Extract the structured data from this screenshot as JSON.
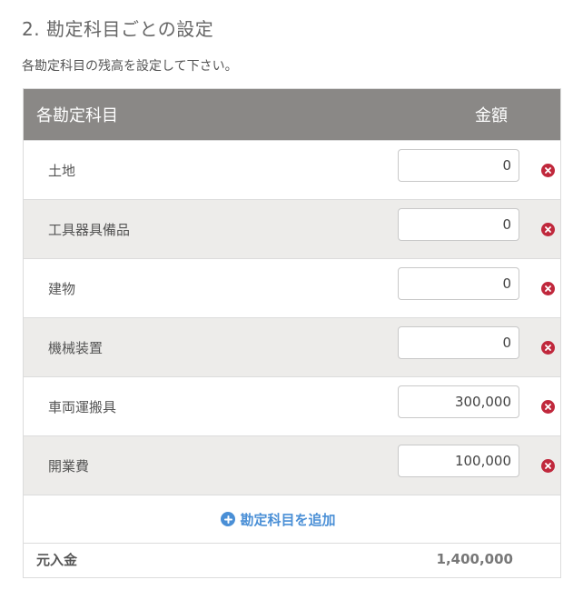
{
  "section": {
    "title": "2. 勘定科目ごとの設定",
    "description": "各勘定科目の残高を設定して下さい。"
  },
  "table": {
    "header_name": "各勘定科目",
    "header_amount": "金額",
    "rows": [
      {
        "label": "土地",
        "amount": "0"
      },
      {
        "label": "工具器具備品",
        "amount": "0"
      },
      {
        "label": "建物",
        "amount": "0"
      },
      {
        "label": "機械装置",
        "amount": "0"
      },
      {
        "label": "車両運搬具",
        "amount": "300,000"
      },
      {
        "label": "開業費",
        "amount": "100,000"
      }
    ],
    "add_label": "勘定科目を追加",
    "total_label": "元入金",
    "total_value": "1,400,000"
  },
  "colors": {
    "header_bg": "#8a8886",
    "alt_row_bg": "#edecea",
    "remove_icon": "#c0283c",
    "add_link": "#4a8fd6"
  },
  "icons": {
    "remove": "remove-circle-icon",
    "add": "plus-circle-icon"
  }
}
